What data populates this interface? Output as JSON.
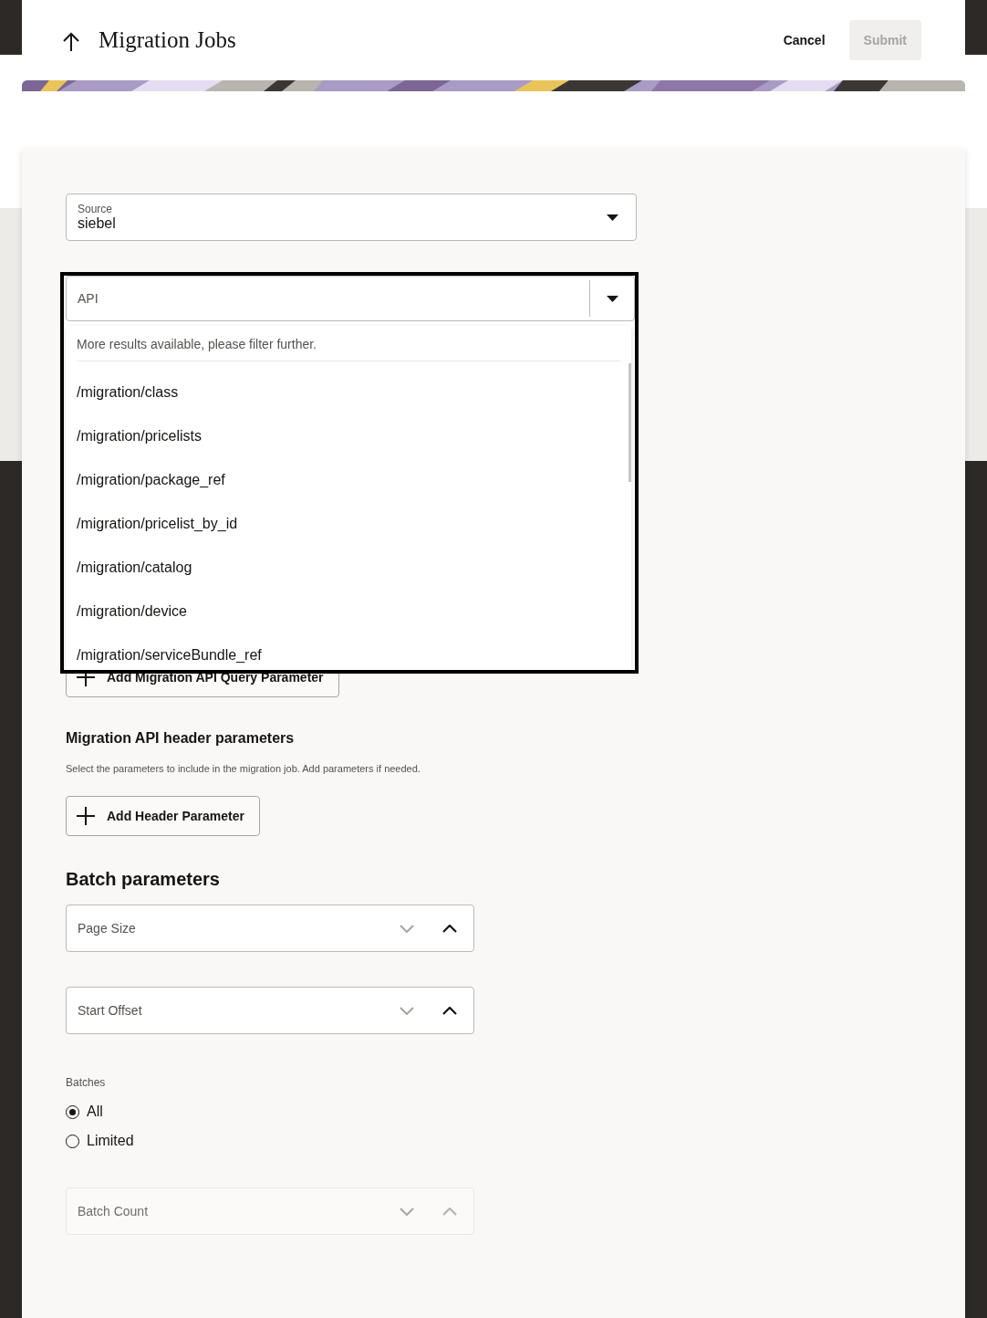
{
  "header": {
    "title": "Migration Jobs",
    "cancel": "Cancel",
    "submit": {
      "label": "Submit",
      "disabled": true
    }
  },
  "form": {
    "source": {
      "label": "Source",
      "value": "siebel"
    },
    "api": {
      "placeholder": "API",
      "expanded": true,
      "message": "More results available, please filter further.",
      "options": [
        {
          "label": "/migration/class",
          "selected": false
        },
        {
          "label": "/migration/pricelists",
          "selected": false
        },
        {
          "label": "/migration/package_ref",
          "selected": false
        },
        {
          "label": "/migration/pricelist_by_id",
          "selected": false
        },
        {
          "label": "/migration/catalog",
          "selected": false
        },
        {
          "label": "/migration/device",
          "selected": false
        },
        {
          "label": "/migration/serviceBundle_ref",
          "selected": false
        }
      ]
    },
    "query_button": "Add Migration API Query Parameter",
    "header_section": {
      "title": "Migration API header parameters",
      "description": "Select the parameters to include in the migration job. Add parameters if needed.",
      "button": "Add Header Parameter"
    },
    "batch": {
      "title": "Batch parameters",
      "items": [
        {
          "kind": "number",
          "placeholder": "Page Size",
          "disabled": false
        },
        {
          "kind": "number",
          "placeholder": "Start Offset",
          "disabled": false
        },
        {
          "kind": "radio",
          "label": "Batches",
          "options": [
            {
              "label": "All",
              "selected": true
            },
            {
              "label": "Limited",
              "selected": false
            }
          ]
        },
        {
          "kind": "number",
          "placeholder": "Batch Count",
          "disabled": true
        }
      ]
    }
  }
}
